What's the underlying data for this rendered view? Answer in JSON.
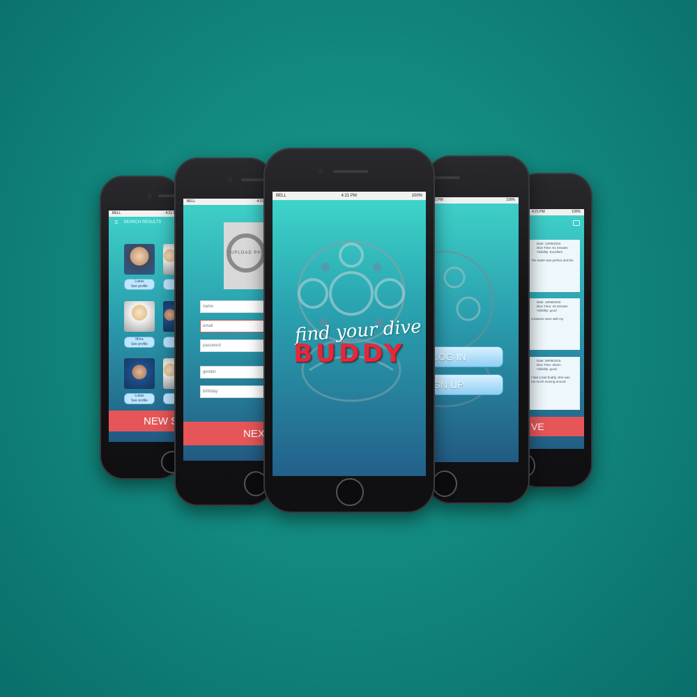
{
  "status": {
    "carrier": "BELL",
    "time": "4:21 PM",
    "battery": "100%"
  },
  "phone1": {
    "header": "SEARCH RESULTS",
    "cards": [
      {
        "name": "Lukas",
        "sub": "See profile"
      },
      {
        "name": "Mirra",
        "sub": "See profile"
      },
      {
        "name": "Lukas",
        "sub": "See profile"
      }
    ],
    "button": "NEW S"
  },
  "phone2": {
    "photo_label": "UPLOAD PH",
    "fields": [
      "name",
      "email",
      "password",
      "gender",
      "birthday"
    ],
    "button": "NEX"
  },
  "phone3": {
    "tagline": "find your dive",
    "brand": "BUDDY"
  },
  "phone4": {
    "login": "LOG IN",
    "signup": "GN UP"
  },
  "phone5": {
    "entries": [
      {
        "date": "Date: 12/08/2015",
        "l1": "Dive Time: 61 minutes",
        "l2": "Visibility: Excellent",
        "l3": "The water was perfect and the"
      },
      {
        "date": "Date: 10/08/2015",
        "l1": "Dive Time: 40 minutes",
        "l2": "Visibility: good",
        "l3": "creatures were with my"
      },
      {
        "date": "Date: 06/08/2015",
        "l1": "Dive Time: 55min",
        "l2": "Visibility: good",
        "l3": "I had a bad buddy. She was\ntoo much moving around"
      }
    ],
    "button": "VE"
  }
}
